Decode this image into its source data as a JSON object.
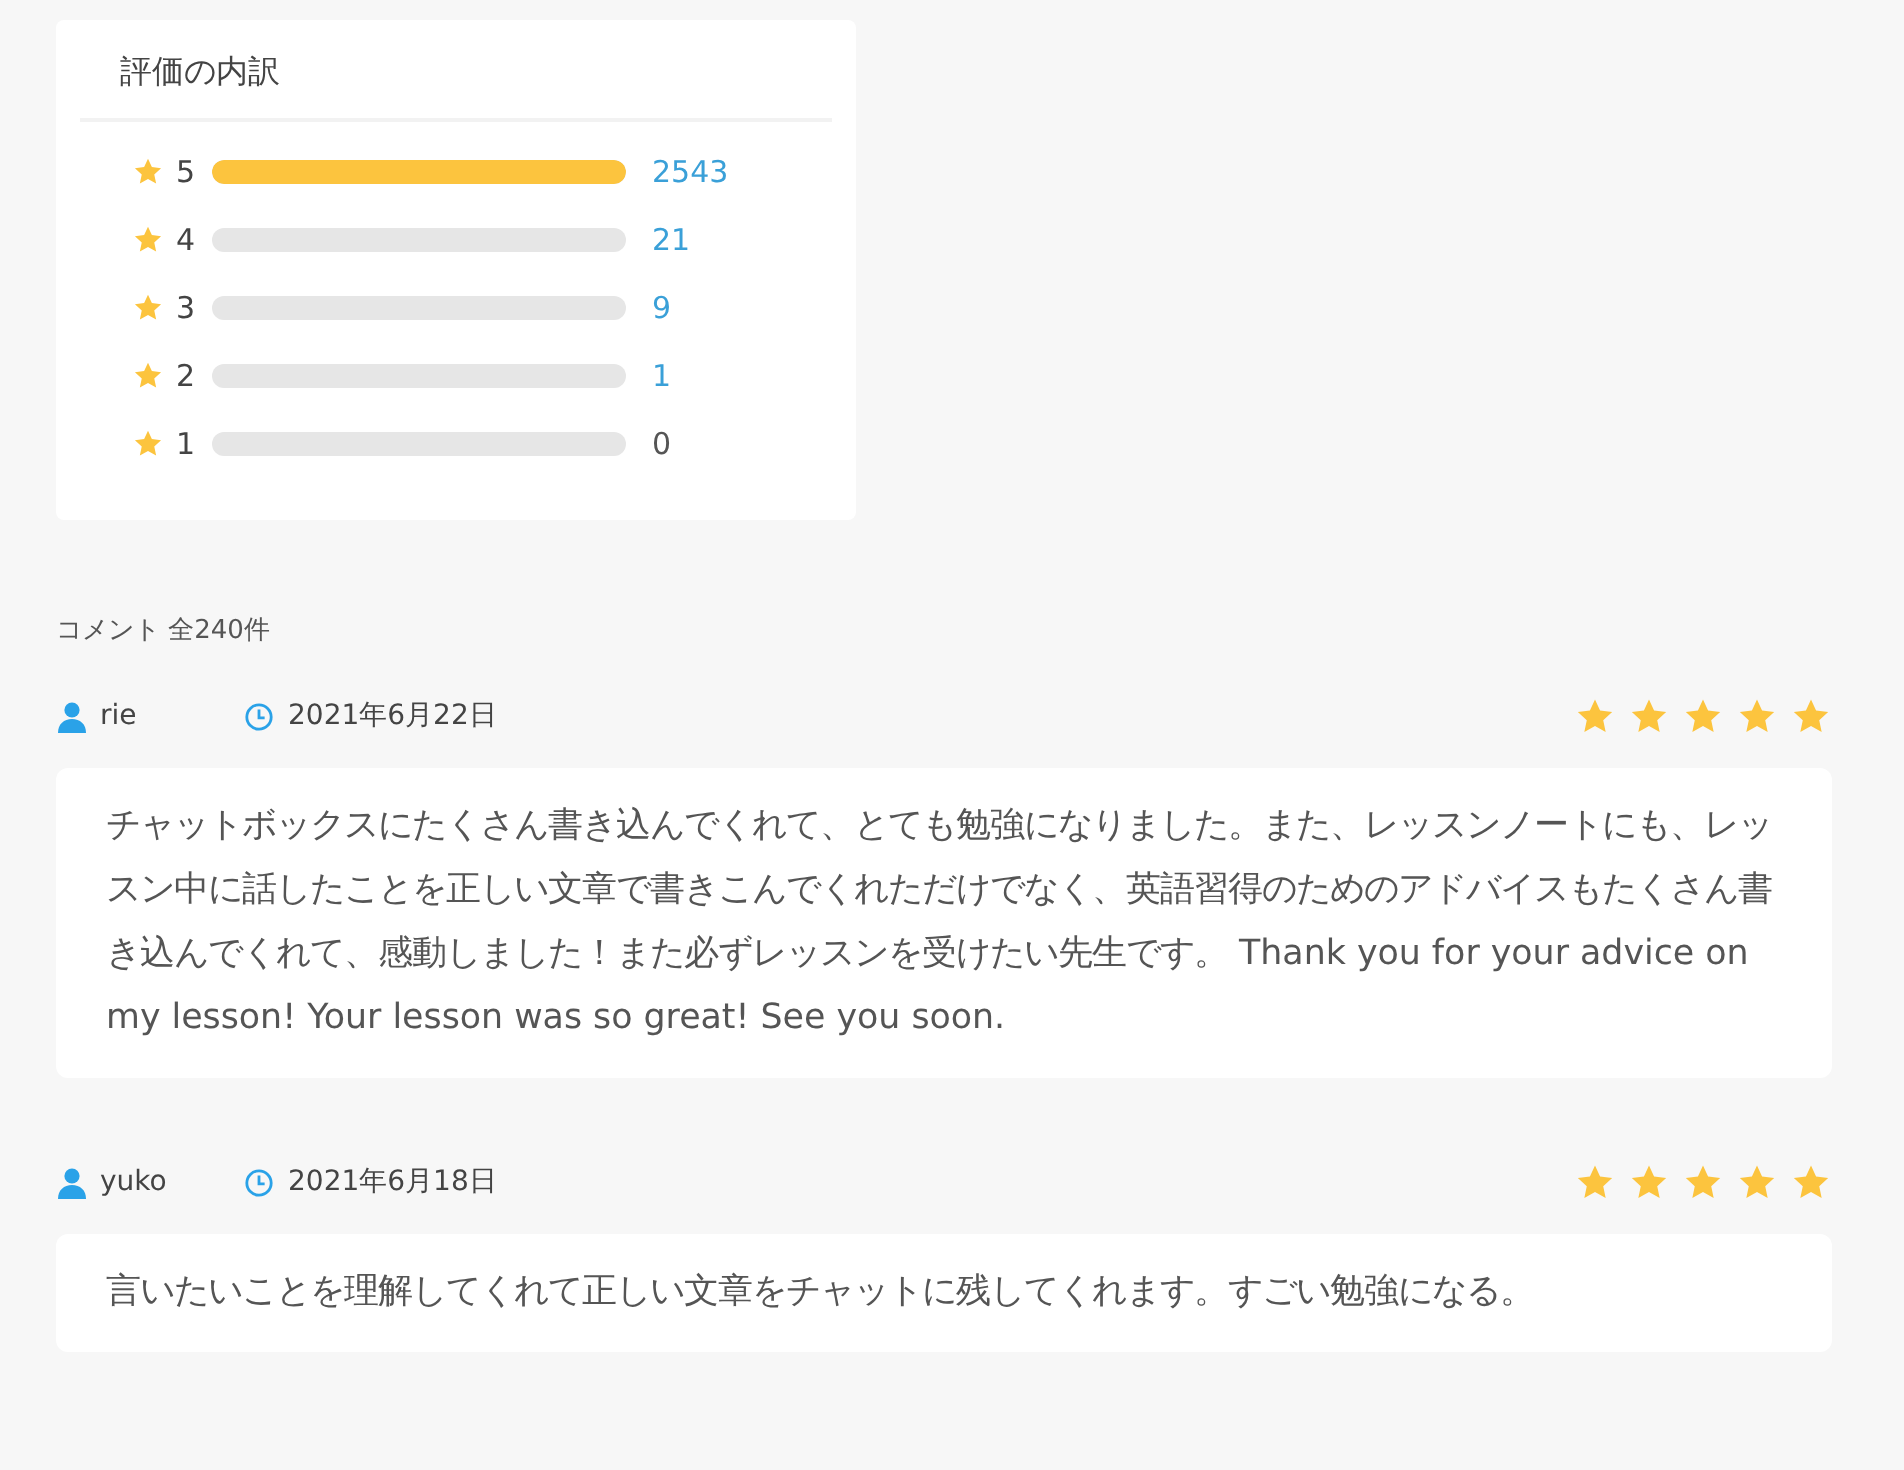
{
  "breakdown": {
    "title": "評価の内訳",
    "rows": [
      {
        "label": "5",
        "level": 1,
        "count": "2543",
        "linked": true
      },
      {
        "label": "4",
        "level": 0,
        "count": "21",
        "linked": true
      },
      {
        "label": "3",
        "level": 0,
        "count": "9",
        "linked": true
      },
      {
        "label": "2",
        "level": 0,
        "count": "1",
        "linked": true
      },
      {
        "label": "1",
        "level": 0,
        "count": "0",
        "linked": false
      }
    ]
  },
  "comments_heading": "コメント 全240件",
  "comments": [
    {
      "user": "rie",
      "date": "2021年6月22日",
      "stars": 5,
      "text": "チャットボックスにたくさん書き込んでくれて、とても勉強になりました。また、レッスンノートにも、レッスン中に話したことを正しい文章で書きこんでくれただけでなく、英語習得のためのアドバイスもたくさん書き込んでくれて、感動しました！また必ずレッスンを受けたい先生です。 Thank you for your advice on my lesson!   Your lesson was so great! See you soon."
    },
    {
      "user": "yuko",
      "date": "2021年6月18日",
      "stars": 5,
      "text": "言いたいことを理解してくれて正しい文章をチャットに残してくれます。すごい勉強になる。"
    }
  ]
}
